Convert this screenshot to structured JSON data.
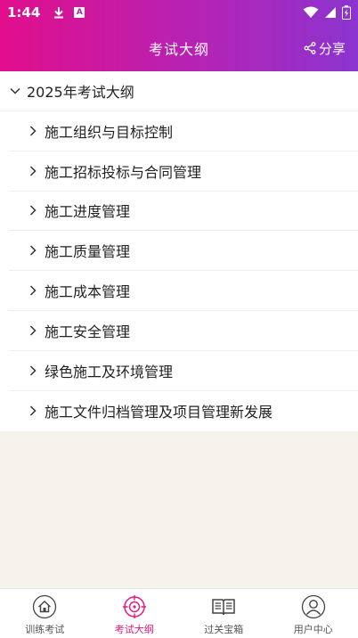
{
  "status_bar": {
    "time": "1:44",
    "icons": [
      "download-icon",
      "a-icon",
      "wifi-icon",
      "signal-icon",
      "battery-icon"
    ]
  },
  "header": {
    "title": "考试大纲",
    "share_label": "分享",
    "gradient_colors": [
      "#e20e8c",
      "#8b34cf"
    ]
  },
  "outline": {
    "root_label": "2025年考试大纲",
    "items": [
      {
        "label": "施工组织与目标控制"
      },
      {
        "label": "施工招标投标与合同管理"
      },
      {
        "label": "施工进度管理"
      },
      {
        "label": "施工质量管理"
      },
      {
        "label": "施工成本管理"
      },
      {
        "label": "施工安全管理"
      },
      {
        "label": "绿色施工及环境管理"
      },
      {
        "label": "施工文件归档管理及项目管理新发展"
      }
    ]
  },
  "bottom_nav": {
    "active_color": "#e5197a",
    "items": [
      {
        "label": "训练考试",
        "icon": "home-icon",
        "active": false
      },
      {
        "label": "考试大纲",
        "icon": "target-icon",
        "active": true
      },
      {
        "label": "过关宝箱",
        "icon": "book-icon",
        "active": false
      },
      {
        "label": "用户中心",
        "icon": "user-icon",
        "active": false
      }
    ]
  }
}
